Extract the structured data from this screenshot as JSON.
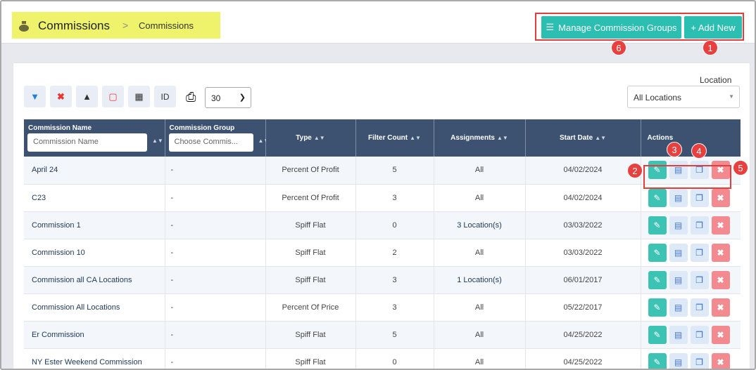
{
  "header": {
    "title": "Commissions",
    "breadcrumb_sep": ">",
    "breadcrumb_current": "Commissions",
    "manage_groups_label": "Manage Commission Groups",
    "add_new_label": "+ Add New"
  },
  "callouts": [
    "1",
    "2",
    "3",
    "4",
    "5",
    "6"
  ],
  "toolbar": {
    "id_label": "ID",
    "per_page": "30",
    "location_label": "Location",
    "location_value": "All Locations"
  },
  "table": {
    "headers": {
      "name": "Commission Name",
      "name_placeholder": "Commission Name",
      "group": "Commission Group",
      "group_placeholder": "Choose Commis...",
      "type": "Type",
      "filter_count": "Filter Count",
      "assignments": "Assignments",
      "start_date": "Start Date",
      "actions": "Actions"
    },
    "rows": [
      {
        "name": "April 24",
        "group": "-",
        "type": "Percent Of Profit",
        "filter_count": "5",
        "assignments": "All",
        "start_date": "04/02/2024"
      },
      {
        "name": "C23",
        "group": "-",
        "type": "Percent Of Profit",
        "filter_count": "3",
        "assignments": "All",
        "start_date": "04/02/2024"
      },
      {
        "name": "Commission 1",
        "group": "-",
        "type": "Spiff Flat",
        "filter_count": "0",
        "assignments": "3 Location(s)",
        "start_date": "03/03/2022"
      },
      {
        "name": "Commission 10",
        "group": "-",
        "type": "Spiff Flat",
        "filter_count": "2",
        "assignments": "All",
        "start_date": "03/03/2022"
      },
      {
        "name": "Commission all CA Locations",
        "group": "-",
        "type": "Spiff Flat",
        "filter_count": "3",
        "assignments": "1 Location(s)",
        "start_date": "06/01/2017"
      },
      {
        "name": "Commission All Locations",
        "group": "-",
        "type": "Percent Of Price",
        "filter_count": "3",
        "assignments": "All",
        "start_date": "05/22/2017"
      },
      {
        "name": "Er Commission",
        "group": "-",
        "type": "Spiff Flat",
        "filter_count": "5",
        "assignments": "All",
        "start_date": "04/25/2022"
      },
      {
        "name": "NY Ester Weekend Commission",
        "group": "-",
        "type": "Spiff Flat",
        "filter_count": "0",
        "assignments": "All",
        "start_date": "04/25/2022"
      }
    ]
  },
  "colors": {
    "accent": "#2bbfb1",
    "header_bg": "#3c5270",
    "highlight": "#eef36b",
    "callout": "#e7403f"
  }
}
